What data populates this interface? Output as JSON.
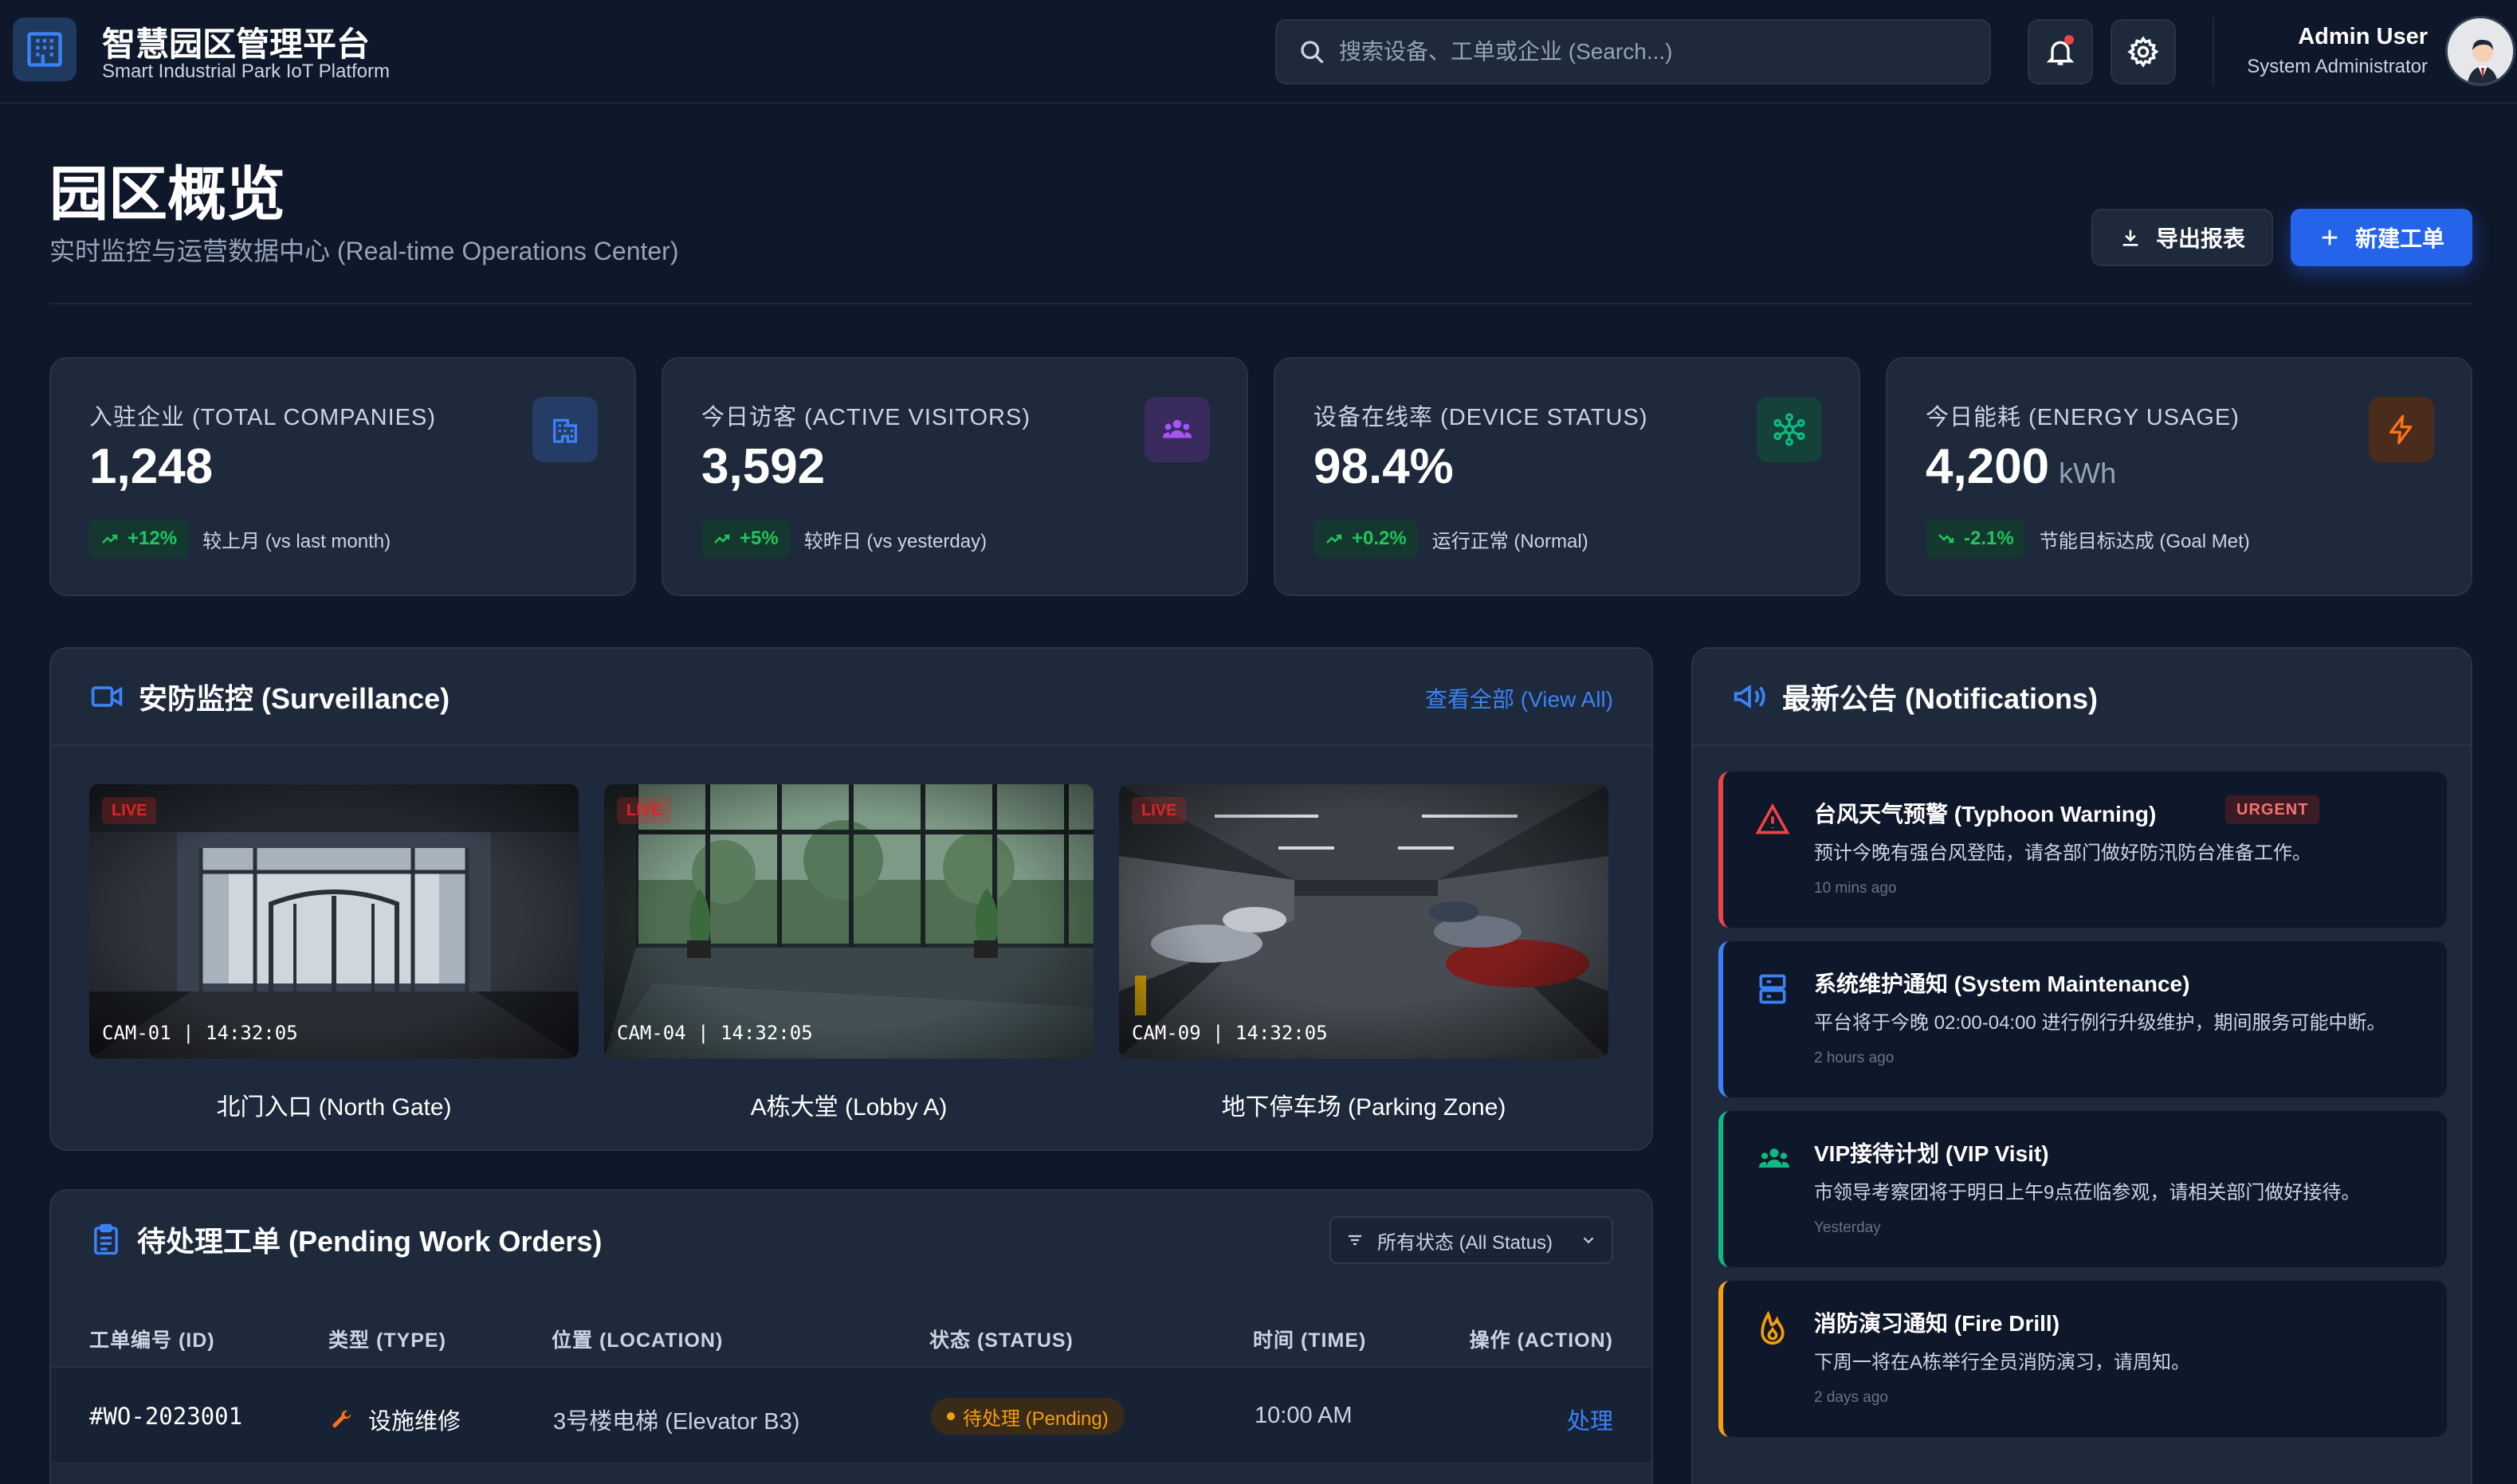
{
  "header": {
    "title": "智慧园区管理平台",
    "subtitle": "Smart Industrial Park IoT Platform",
    "search_placeholder": "搜索设备、工单或企业 (Search...)",
    "user_name": "Admin User",
    "user_role": "System Administrator"
  },
  "page": {
    "title": "园区概览",
    "subtitle": "实时监控与运营数据中心 (Real-time Operations Center)",
    "export_label": "导出报表",
    "new_label": "新建工单"
  },
  "stats": [
    {
      "label": "入驻企业 (TOTAL COMPANIES)",
      "value": "1,248",
      "unit": "",
      "trend": "+12%",
      "note": "较上月 (vs last month)",
      "icon": "building-icon",
      "accent": "#3b82f6"
    },
    {
      "label": "今日访客 (ACTIVE VISITORS)",
      "value": "3,592",
      "unit": "",
      "trend": "+5%",
      "note": "较昨日 (vs yesterday)",
      "icon": "users-icon",
      "accent": "#a855f7"
    },
    {
      "label": "设备在线率 (DEVICE STATUS)",
      "value": "98.4%",
      "unit": "",
      "trend": "+0.2%",
      "note": "运行正常 (Normal)",
      "icon": "network-icon",
      "accent": "#10b981"
    },
    {
      "label": "今日能耗 (ENERGY USAGE)",
      "value": "4,200",
      "unit": "kWh",
      "trend": "-2.1%",
      "note": "节能目标达成 (Goal Met)",
      "icon": "bolt-icon",
      "accent": "#f97316"
    }
  ],
  "surveillance": {
    "title": "安防监控 (Surveillance)",
    "view_all": "查看全部 (View All)",
    "live_label": "LIVE",
    "cameras": [
      {
        "stamp": "CAM-01 | 14:32:05",
        "caption": "北门入口 (North Gate)"
      },
      {
        "stamp": "CAM-04 | 14:32:05",
        "caption": "A栋大堂 (Lobby A)"
      },
      {
        "stamp": "CAM-09 | 14:32:05",
        "caption": "地下停车场 (Parking Zone)"
      }
    ]
  },
  "work_orders": {
    "title": "待处理工单 (Pending Work Orders)",
    "filter": "所有状态 (All Status)",
    "columns": [
      "工单编号 (ID)",
      "类型 (TYPE)",
      "位置 (LOCATION)",
      "状态 (STATUS)",
      "时间 (TIME)",
      "操作 (ACTION)"
    ],
    "rows": [
      {
        "id": "#WO-2023001",
        "type": "设施维修",
        "location": "3号楼电梯 (Elevator B3)",
        "status": "待处理 (Pending)",
        "time": "10:00 AM",
        "action": "处理"
      }
    ]
  },
  "notifications": {
    "title": "最新公告 (Notifications)",
    "items": [
      {
        "title": "台风天气预警 (Typhoon Warning)",
        "badge": "URGENT",
        "body": "预计今晚有强台风登陆，请各部门做好防汛防台准备工作。",
        "time": "10 mins ago",
        "icon": "warning-icon",
        "color": "#ef4444"
      },
      {
        "title": "系统维护通知 (System Maintenance)",
        "badge": "",
        "body": "平台将于今晚 02:00-04:00 进行例行升级维护，期间服务可能中断。",
        "time": "2 hours ago",
        "icon": "server-icon",
        "color": "#3b82f6"
      },
      {
        "title": "VIP接待计划 (VIP Visit)",
        "badge": "",
        "body": "市领导考察团将于明日上午9点莅临参观，请相关部门做好接待。",
        "time": "Yesterday",
        "icon": "users-icon",
        "color": "#10b981"
      },
      {
        "title": "消防演习通知 (Fire Drill)",
        "badge": "",
        "body": "下周一将在A栋举行全员消防演习，请周知。",
        "time": "2 days ago",
        "icon": "fire-icon",
        "color": "#f59e0b"
      }
    ]
  }
}
